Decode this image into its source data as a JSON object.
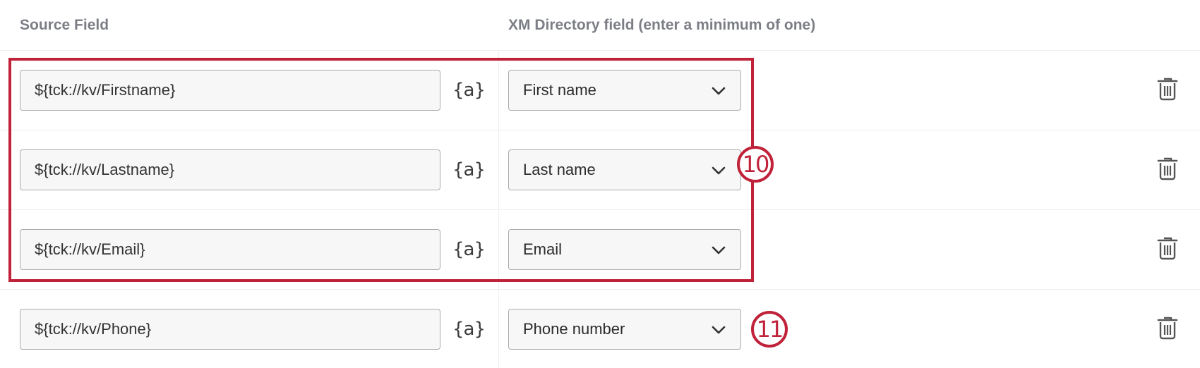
{
  "headers": {
    "source_field": "Source Field",
    "xm_directory_field": "XM Directory field (enter a minimum of one)"
  },
  "rows": [
    {
      "source_value": "${tck://kv/Firstname}",
      "piped_text_icon": "{a}",
      "directory_field": "First name"
    },
    {
      "source_value": "${tck://kv/Lastname}",
      "piped_text_icon": "{a}",
      "directory_field": "Last name"
    },
    {
      "source_value": "${tck://kv/Email}",
      "piped_text_icon": "{a}",
      "directory_field": "Email"
    },
    {
      "source_value": "${tck://kv/Phone}",
      "piped_text_icon": "{a}",
      "directory_field": "Phone number"
    }
  ],
  "callouts": {
    "first": "10",
    "second": "11"
  },
  "icons": {
    "dropdown": "chevron-down-icon",
    "delete": "trash-icon",
    "piped_text": "piped-text-icon"
  },
  "colors": {
    "annotation": "#c0223a",
    "header_text": "#7b7e84",
    "field_border": "#a9abae",
    "field_background": "#f7f7f7"
  }
}
